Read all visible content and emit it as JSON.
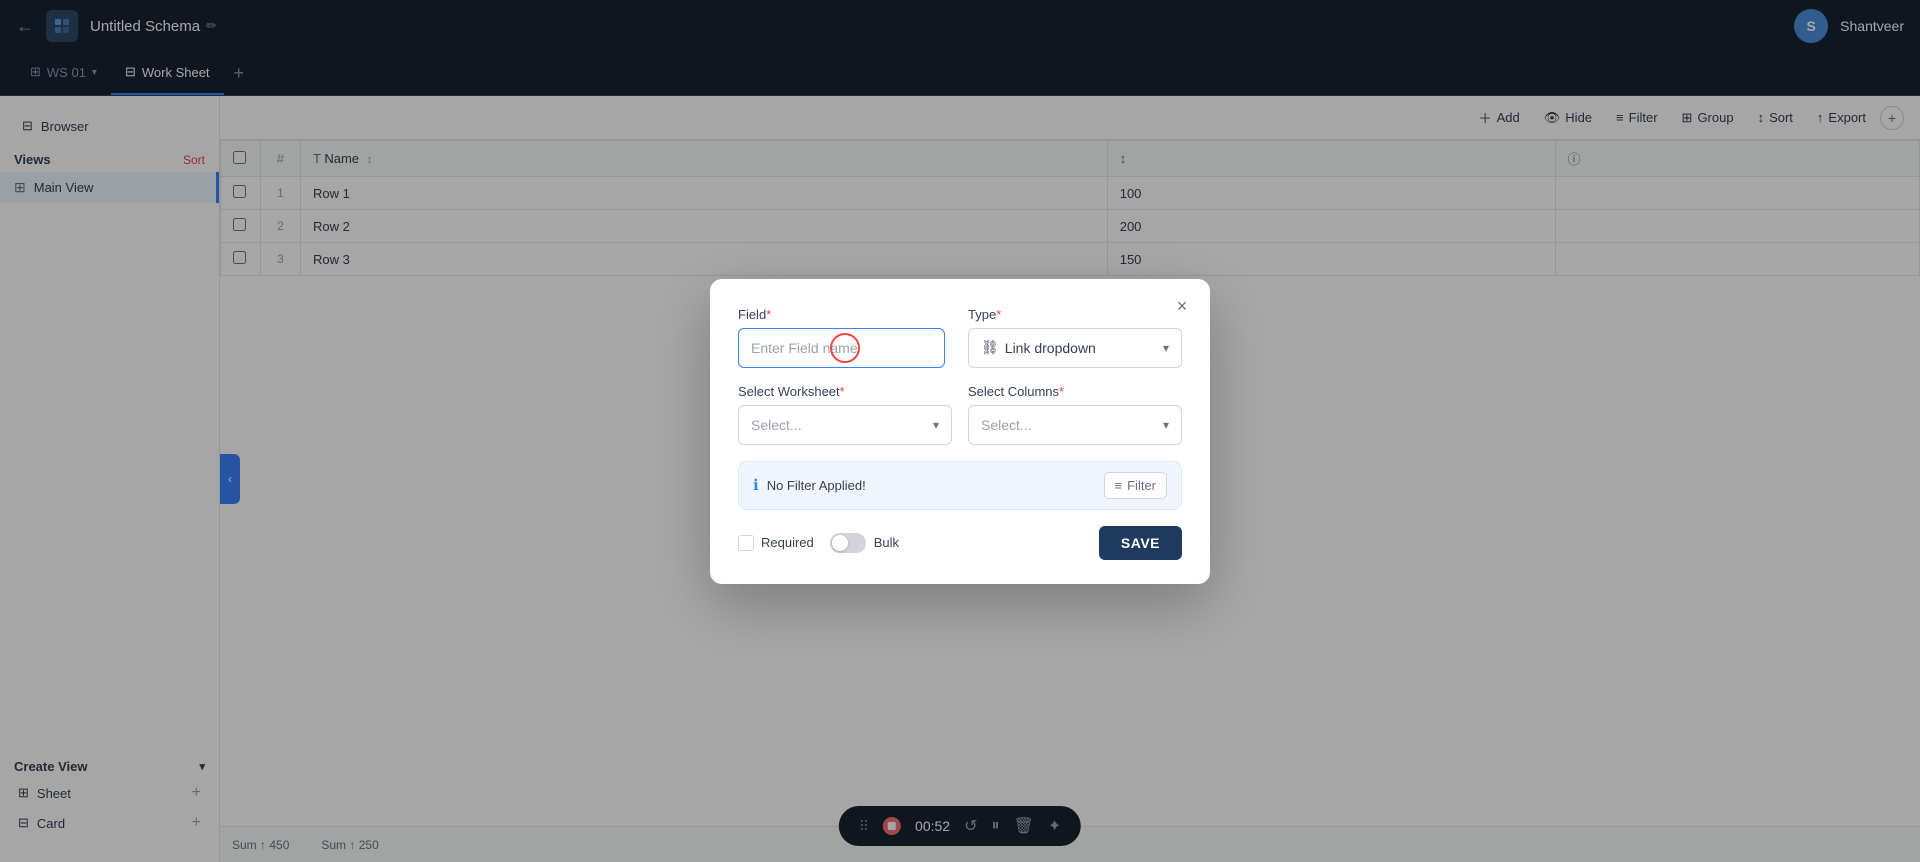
{
  "app": {
    "title": "Untitled Schema",
    "back_icon": "←",
    "edit_icon": "✏",
    "logo_icon": "⬡",
    "user_initial": "S",
    "username": "Shantveer"
  },
  "tabs": [
    {
      "id": "ws01",
      "label": "WS 01",
      "active": true,
      "icon": "⊞"
    },
    {
      "id": "worksheet",
      "label": "Work Sheet",
      "active": false,
      "icon": "⊟"
    },
    {
      "id": "add",
      "label": "+",
      "active": false,
      "icon": ""
    }
  ],
  "sidebar": {
    "browser_label": "Browser",
    "views_label": "Views",
    "sort_label": "Sort",
    "main_view_label": "Main View",
    "create_view_label": "Create View",
    "sheet_label": "Sheet",
    "card_label": "Card"
  },
  "toolbar": {
    "add_label": "Add",
    "hide_label": "Hide",
    "filter_label": "Filter",
    "group_label": "Group",
    "sort_label": "Sort",
    "export_label": "Export"
  },
  "table": {
    "columns": [
      {
        "id": "check",
        "label": ""
      },
      {
        "id": "num",
        "label": ""
      },
      {
        "id": "name",
        "label": "Name",
        "icon": "T"
      },
      {
        "id": "col2",
        "label": "",
        "icon": "↕"
      },
      {
        "id": "col3",
        "label": "",
        "icon": "ⓘ"
      }
    ],
    "rows": [
      {
        "num": 1,
        "name": "Row 1",
        "col2": "100",
        "col3": ""
      },
      {
        "num": 2,
        "name": "Row 2",
        "col2": "200",
        "col3": ""
      },
      {
        "num": 3,
        "name": "Row 3",
        "col2": "150",
        "col3": ""
      }
    ],
    "footer": [
      {
        "label": "Sum",
        "arrow": "↑",
        "value": "450"
      },
      {
        "label": "Sum",
        "arrow": "↑",
        "value": "250"
      }
    ]
  },
  "modal": {
    "field_label": "Field",
    "field_placeholder": "Enter Field name",
    "type_label": "Type",
    "type_value": "Link dropdown",
    "type_icon": "⛓",
    "worksheet_label": "Select Worksheet",
    "worksheet_placeholder": "Select...",
    "columns_label": "Select Columns",
    "columns_placeholder": "Select...",
    "no_filter_text": "No Filter Applied!",
    "filter_btn_label": "Filter",
    "required_label": "Required",
    "bulk_label": "Bulk",
    "save_label": "SAVE",
    "close_icon": "×",
    "required_asterisk": "*",
    "info_icon": "ℹ"
  },
  "recording": {
    "time": "00:52"
  },
  "colors": {
    "accent": "#3b82f6",
    "danger": "#ef4444",
    "nav_bg": "#1a2332",
    "save_bg": "#1e3a5f"
  }
}
